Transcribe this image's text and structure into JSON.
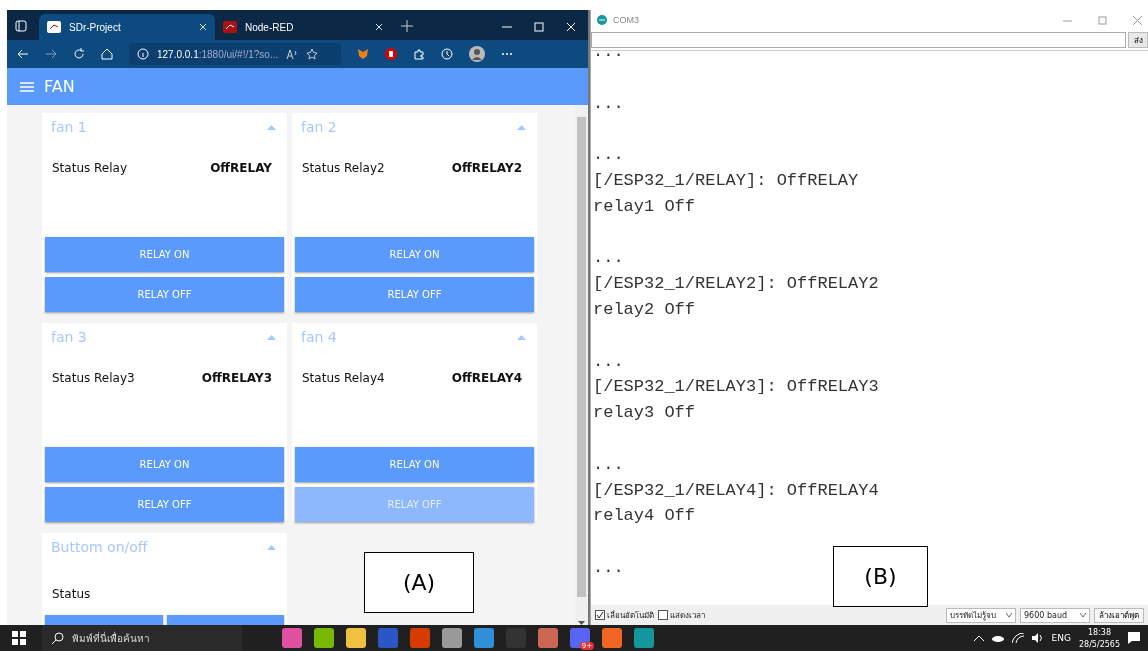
{
  "browser": {
    "tabs": [
      {
        "title": "SDr-Project",
        "selected": true
      },
      {
        "title": "Node-RED",
        "selected": false
      }
    ],
    "address": {
      "host": "127.0.0.1",
      "rest": ":1880/ui/#!/1?so..."
    },
    "dashboard": {
      "title": "FAN",
      "groups": [
        {
          "title": "fan 1",
          "rows": [
            {
              "label": "Status Relay",
              "value": "OffRELAY"
            }
          ],
          "buttons": [
            {
              "label": "RELAY ON",
              "faded": false
            },
            {
              "label": "RELAY OFF",
              "faded": false
            }
          ]
        },
        {
          "title": "fan 2",
          "rows": [
            {
              "label": "Status Relay2",
              "value": "OffRELAY2"
            }
          ],
          "buttons": [
            {
              "label": "RELAY ON",
              "faded": false
            },
            {
              "label": "RELAY OFF",
              "faded": false
            }
          ]
        },
        {
          "title": "fan 3",
          "rows": [
            {
              "label": "Status Relay3",
              "value": "OffRELAY3"
            }
          ],
          "buttons": [
            {
              "label": "RELAY ON",
              "faded": false
            },
            {
              "label": "RELAY OFF",
              "faded": false
            }
          ]
        },
        {
          "title": "fan 4",
          "rows": [
            {
              "label": "Status Relay4",
              "value": "OffRELAY4"
            }
          ],
          "buttons": [
            {
              "label": "RELAY ON",
              "faded": false
            },
            {
              "label": "RELAY OFF",
              "faded": true
            }
          ]
        },
        {
          "title": "Buttom on/off",
          "rows": [
            {
              "label": "Status"
            }
          ],
          "buttons": [
            {
              "faded": false
            },
            {
              "faded": false
            }
          ],
          "half": true
        }
      ]
    }
  },
  "serial_monitor": {
    "title": "COM3",
    "send_button": "ส่ง",
    "output_blocks": [
      [
        "..."
      ],
      [
        "..."
      ],
      [
        "...",
        "[/ESP32_1/RELAY]: OffRELAY",
        "relay1 Off"
      ],
      [
        "...",
        "[/ESP32_1/RELAY2]: OffRELAY2",
        "relay2 Off"
      ],
      [
        "...",
        "[/ESP32_1/RELAY3]: OffRELAY3",
        "relay3 Off"
      ],
      [
        "...",
        "[/ESP32_1/RELAY4]: OffRELAY4",
        "relay4 Off"
      ],
      [
        "..."
      ]
    ],
    "autoscroll": {
      "label": "เลื่อนอัตโนมัติ",
      "checked": true
    },
    "timestamp": {
      "label": "แสดงเวลา",
      "checked": false
    },
    "line_ending": "บรรทัดไม่รู้จบ",
    "baud": "9600 baud",
    "clear_button": "ล้างเอาต์พุต"
  },
  "annotations": [
    "(A)",
    "(B)"
  ],
  "taskbar": {
    "search_placeholder": "พิมพ์ที่นี่เพื่อค้นหา",
    "badge": "9+",
    "language": "ENG",
    "time": "18:38",
    "date": "28/5/2565"
  }
}
